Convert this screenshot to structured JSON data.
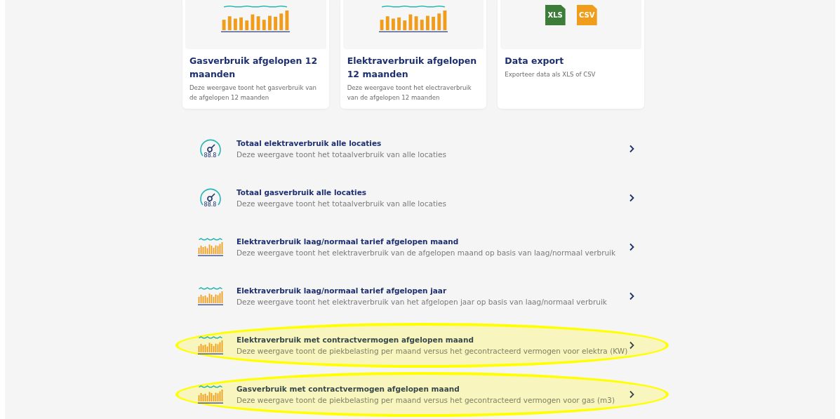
{
  "cards": [
    {
      "kind": "chart",
      "title": "Gasverbruik afgelopen 12 maanden",
      "description": "Deze weergave toont het gasverbruik van de afgelopen 12 maanden"
    },
    {
      "kind": "chart",
      "title": "Elektraverbruik afgelopen 12 maanden",
      "description": "Deze weergave toont het electraverbruik van de afgelopen 12 maanden"
    },
    {
      "kind": "export",
      "title": "Data export",
      "description": "Exporteer data als XLS of CSV",
      "badges": [
        "XLS",
        "CSV"
      ]
    }
  ],
  "reports": [
    {
      "kind": "gauge",
      "gauge_reading": "88.8",
      "title": "Totaal elektraverbruik alle locaties",
      "description": "Deze weergave toont het totaalverbruik van alle locaties",
      "highlighted": false
    },
    {
      "kind": "gauge",
      "gauge_reading": "88.8",
      "title": "Totaal gasverbruik alle locaties",
      "description": "Deze weergave toont het totaalverbruik van alle locaties",
      "highlighted": false
    },
    {
      "kind": "chart",
      "title": "Elektraverbruik laag/normaal tarief afgelopen maand",
      "description": "Deze weergave toont het elektraverbruik van de afgelopen maand op basis van laag/normaal verbruik",
      "highlighted": false
    },
    {
      "kind": "chart",
      "title": "Elektraverbruik laag/normaal tarief afgelopen jaar",
      "description": "Deze weergave toont het elektraverbruik van het afgelopen jaar op basis van laag/normaal verbruik",
      "highlighted": false
    },
    {
      "kind": "chart",
      "title": "Elektraverbruik met contractvermogen afgelopen maand",
      "description": "Deze weergave toont de piekbelasting per maand versus het gecontracteerd vermogen voor elektra (KW)",
      "highlighted": true
    },
    {
      "kind": "chart",
      "title": "Gasverbruik met contractvermogen afgelopen maand",
      "description": "Deze weergave toont de piekbelasting per maand versus het gecontracteerd vermogen voor gas (m3)",
      "highlighted": true
    }
  ]
}
